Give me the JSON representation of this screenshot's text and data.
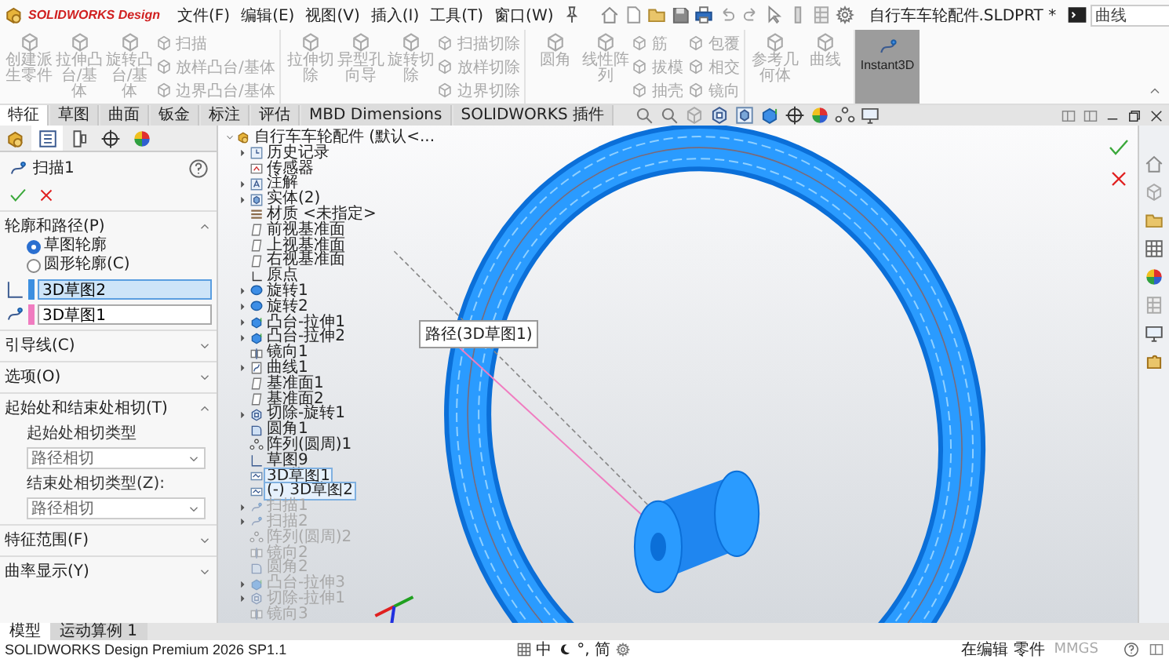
{
  "app": {
    "logo": "SOLIDWORKS Design"
  },
  "menu": [
    "文件(F)",
    "编辑(E)",
    "视图(V)",
    "插入(I)",
    "工具(T)",
    "窗口(W)"
  ],
  "document_title": "自行车车轮配件.SLDPRT *",
  "search": {
    "value": "曲线"
  },
  "ribbon": {
    "groups": [
      {
        "large": [
          {
            "label": "创建派生零件",
            "disabled": true
          },
          {
            "label": "拉伸凸台/基体",
            "disabled": true
          },
          {
            "label": "旋转凸台/基体",
            "disabled": true
          }
        ],
        "small": [
          {
            "label": "扫描",
            "disabled": true
          },
          {
            "label": "放样凸台/基体",
            "disabled": true
          },
          {
            "label": "边界凸台/基体",
            "disabled": true
          }
        ]
      },
      {
        "large": [
          {
            "label": "拉伸切除",
            "disabled": true
          },
          {
            "label": "异型孔向导",
            "disabled": true
          },
          {
            "label": "旋转切除",
            "disabled": true
          }
        ],
        "small": [
          {
            "label": "扫描切除",
            "disabled": true
          },
          {
            "label": "放样切除",
            "disabled": true
          },
          {
            "label": "边界切除",
            "disabled": true
          }
        ]
      },
      {
        "large": [
          {
            "label": "圆角",
            "disabled": true
          },
          {
            "label": "线性阵列",
            "disabled": true
          }
        ],
        "small": [
          {
            "label": "筋",
            "disabled": true
          },
          {
            "label": "拔模",
            "disabled": true
          },
          {
            "label": "抽壳",
            "disabled": true
          },
          {
            "label": "包覆",
            "disabled": true
          },
          {
            "label": "相交",
            "disabled": true
          },
          {
            "label": "镜向",
            "disabled": true
          }
        ]
      },
      {
        "large": [
          {
            "label": "参考几何体",
            "disabled": true
          },
          {
            "label": "曲线",
            "disabled": true
          }
        ]
      }
    ],
    "instant3d": {
      "label": "Instant3D",
      "selected": true
    }
  },
  "tabs": [
    {
      "label": "特征",
      "selected": true
    },
    {
      "label": "草图",
      "selected": false
    },
    {
      "label": "曲面",
      "selected": false
    },
    {
      "label": "钣金",
      "selected": false
    },
    {
      "label": "标注",
      "selected": false
    },
    {
      "label": "评估",
      "selected": false
    },
    {
      "label": "MBD Dimensions",
      "selected": false
    },
    {
      "label": "SOLIDWORKS 插件",
      "selected": false
    }
  ],
  "property_manager": {
    "title": "扫描1",
    "sections": [
      {
        "kind": "profile_path",
        "title": "轮廓和路径(P)",
        "expanded": true,
        "options": [
          {
            "label": "草图轮廓",
            "selected": true
          },
          {
            "label": "圆形轮廓(C)",
            "selected": false
          }
        ],
        "selections": [
          {
            "value": "3D草图2",
            "color": "#3d8fe0",
            "selected": true
          },
          {
            "value": "3D草图1",
            "color": "#f07cc0",
            "selected": false
          }
        ]
      },
      {
        "kind": "plain",
        "title": "引导线(C)",
        "expanded": false
      },
      {
        "kind": "plain",
        "title": "选项(O)",
        "expanded": false
      },
      {
        "kind": "tangency",
        "title": "起始处和结束处相切(T)",
        "expanded": true,
        "fields": [
          {
            "label": "起始处相切类型",
            "value": "路径相切"
          },
          {
            "label": "结束处相切类型(Z):",
            "value": "路径相切"
          }
        ]
      },
      {
        "kind": "plain",
        "title": "特征范围(F)",
        "expanded": false
      },
      {
        "kind": "plain",
        "title": "曲率显示(Y)",
        "expanded": false
      }
    ]
  },
  "feature_tree": {
    "items": [
      {
        "label": "自行车车轮配件 (默认<...",
        "kind": "part",
        "collapsible": true,
        "expanded": true,
        "selected": false,
        "disabled": false,
        "children": [
          {
            "label": "历史记录",
            "kind": "history",
            "collapsible": true,
            "expanded": false,
            "selected": false,
            "disabled": false
          },
          {
            "label": "传感器",
            "kind": "sensor",
            "collapsible": false,
            "selected": false,
            "disabled": false
          },
          {
            "label": "注解",
            "kind": "annotation",
            "collapsible": true,
            "expanded": false,
            "selected": false,
            "disabled": false
          },
          {
            "label": "实体(2)",
            "kind": "solid",
            "collapsible": true,
            "expanded": false,
            "selected": false,
            "disabled": false
          },
          {
            "label": "材质 <未指定>",
            "kind": "material",
            "collapsible": false,
            "selected": false,
            "disabled": false
          },
          {
            "label": "前视基准面",
            "kind": "plane",
            "collapsible": false,
            "selected": false,
            "disabled": false
          },
          {
            "label": "上视基准面",
            "kind": "plane",
            "collapsible": false,
            "selected": false,
            "disabled": false
          },
          {
            "label": "右视基准面",
            "kind": "plane",
            "collapsible": false,
            "selected": false,
            "disabled": false
          },
          {
            "label": "原点",
            "kind": "origin",
            "collapsible": false,
            "selected": false,
            "disabled": false
          },
          {
            "label": "旋转1",
            "kind": "revolve",
            "collapsible": true,
            "expanded": false,
            "selected": false,
            "disabled": false
          },
          {
            "label": "旋转2",
            "kind": "revolve",
            "collapsible": true,
            "expanded": false,
            "selected": false,
            "disabled": false
          },
          {
            "label": "凸台-拉伸1",
            "kind": "extrude",
            "collapsible": true,
            "expanded": false,
            "selected": false,
            "disabled": false
          },
          {
            "label": "凸台-拉伸2",
            "kind": "extrude",
            "collapsible": true,
            "expanded": false,
            "selected": false,
            "disabled": false
          },
          {
            "label": "镜向1",
            "kind": "mirror",
            "collapsible": false,
            "selected": false,
            "disabled": false
          },
          {
            "label": "曲线1",
            "kind": "curve",
            "collapsible": true,
            "expanded": false,
            "selected": false,
            "disabled": false
          },
          {
            "label": "基准面1",
            "kind": "plane",
            "collapsible": false,
            "selected": false,
            "disabled": false
          },
          {
            "label": "基准面2",
            "kind": "plane",
            "collapsible": false,
            "selected": false,
            "disabled": false
          },
          {
            "label": "切除-旋转1",
            "kind": "cut",
            "collapsible": true,
            "expanded": false,
            "selected": false,
            "disabled": false
          },
          {
            "label": "圆角1",
            "kind": "fillet",
            "collapsible": false,
            "selected": false,
            "disabled": false
          },
          {
            "label": "阵列(圆周)1",
            "kind": "pattern",
            "collapsible": false,
            "selected": false,
            "disabled": false
          },
          {
            "label": "草图9",
            "kind": "sketch",
            "collapsible": false,
            "selected": false,
            "disabled": false
          },
          {
            "label": "3D草图1",
            "kind": "sketch3d",
            "collapsible": false,
            "selected": true,
            "disabled": false
          },
          {
            "label": "(-) 3D草图2",
            "kind": "sketch3d",
            "collapsible": false,
            "selected": true,
            "disabled": false
          },
          {
            "label": "扫描1",
            "kind": "sweep",
            "collapsible": true,
            "expanded": false,
            "selected": false,
            "disabled": true
          },
          {
            "label": "扫描2",
            "kind": "sweep",
            "collapsible": true,
            "expanded": false,
            "selected": false,
            "disabled": true
          },
          {
            "label": "阵列(圆周)2",
            "kind": "pattern",
            "collapsible": false,
            "selected": false,
            "disabled": true
          },
          {
            "label": "镜向2",
            "kind": "mirror",
            "collapsible": false,
            "selected": false,
            "disabled": true
          },
          {
            "label": "圆角2",
            "kind": "fillet",
            "collapsible": false,
            "selected": false,
            "disabled": true
          },
          {
            "label": "凸台-拉伸3",
            "kind": "extrude",
            "collapsible": true,
            "expanded": false,
            "selected": false,
            "disabled": true
          },
          {
            "label": "切除-拉伸1",
            "kind": "cut",
            "collapsible": true,
            "expanded": false,
            "selected": false,
            "disabled": true
          },
          {
            "label": "镜向3",
            "kind": "mirror",
            "collapsible": false,
            "selected": false,
            "disabled": true
          }
        ]
      }
    ]
  },
  "tooltip": "路径(3D草图1)",
  "bottom_tabs": [
    {
      "label": "模型",
      "selected": true
    },
    {
      "label": "运动算例 1",
      "selected": false
    }
  ],
  "status_bar": {
    "product": "SOLIDWORKS Design Premium 2026 SP1.1",
    "ime": [
      "中",
      "°,",
      "简"
    ],
    "mode": "在编辑 零件",
    "units": "MMGS"
  }
}
